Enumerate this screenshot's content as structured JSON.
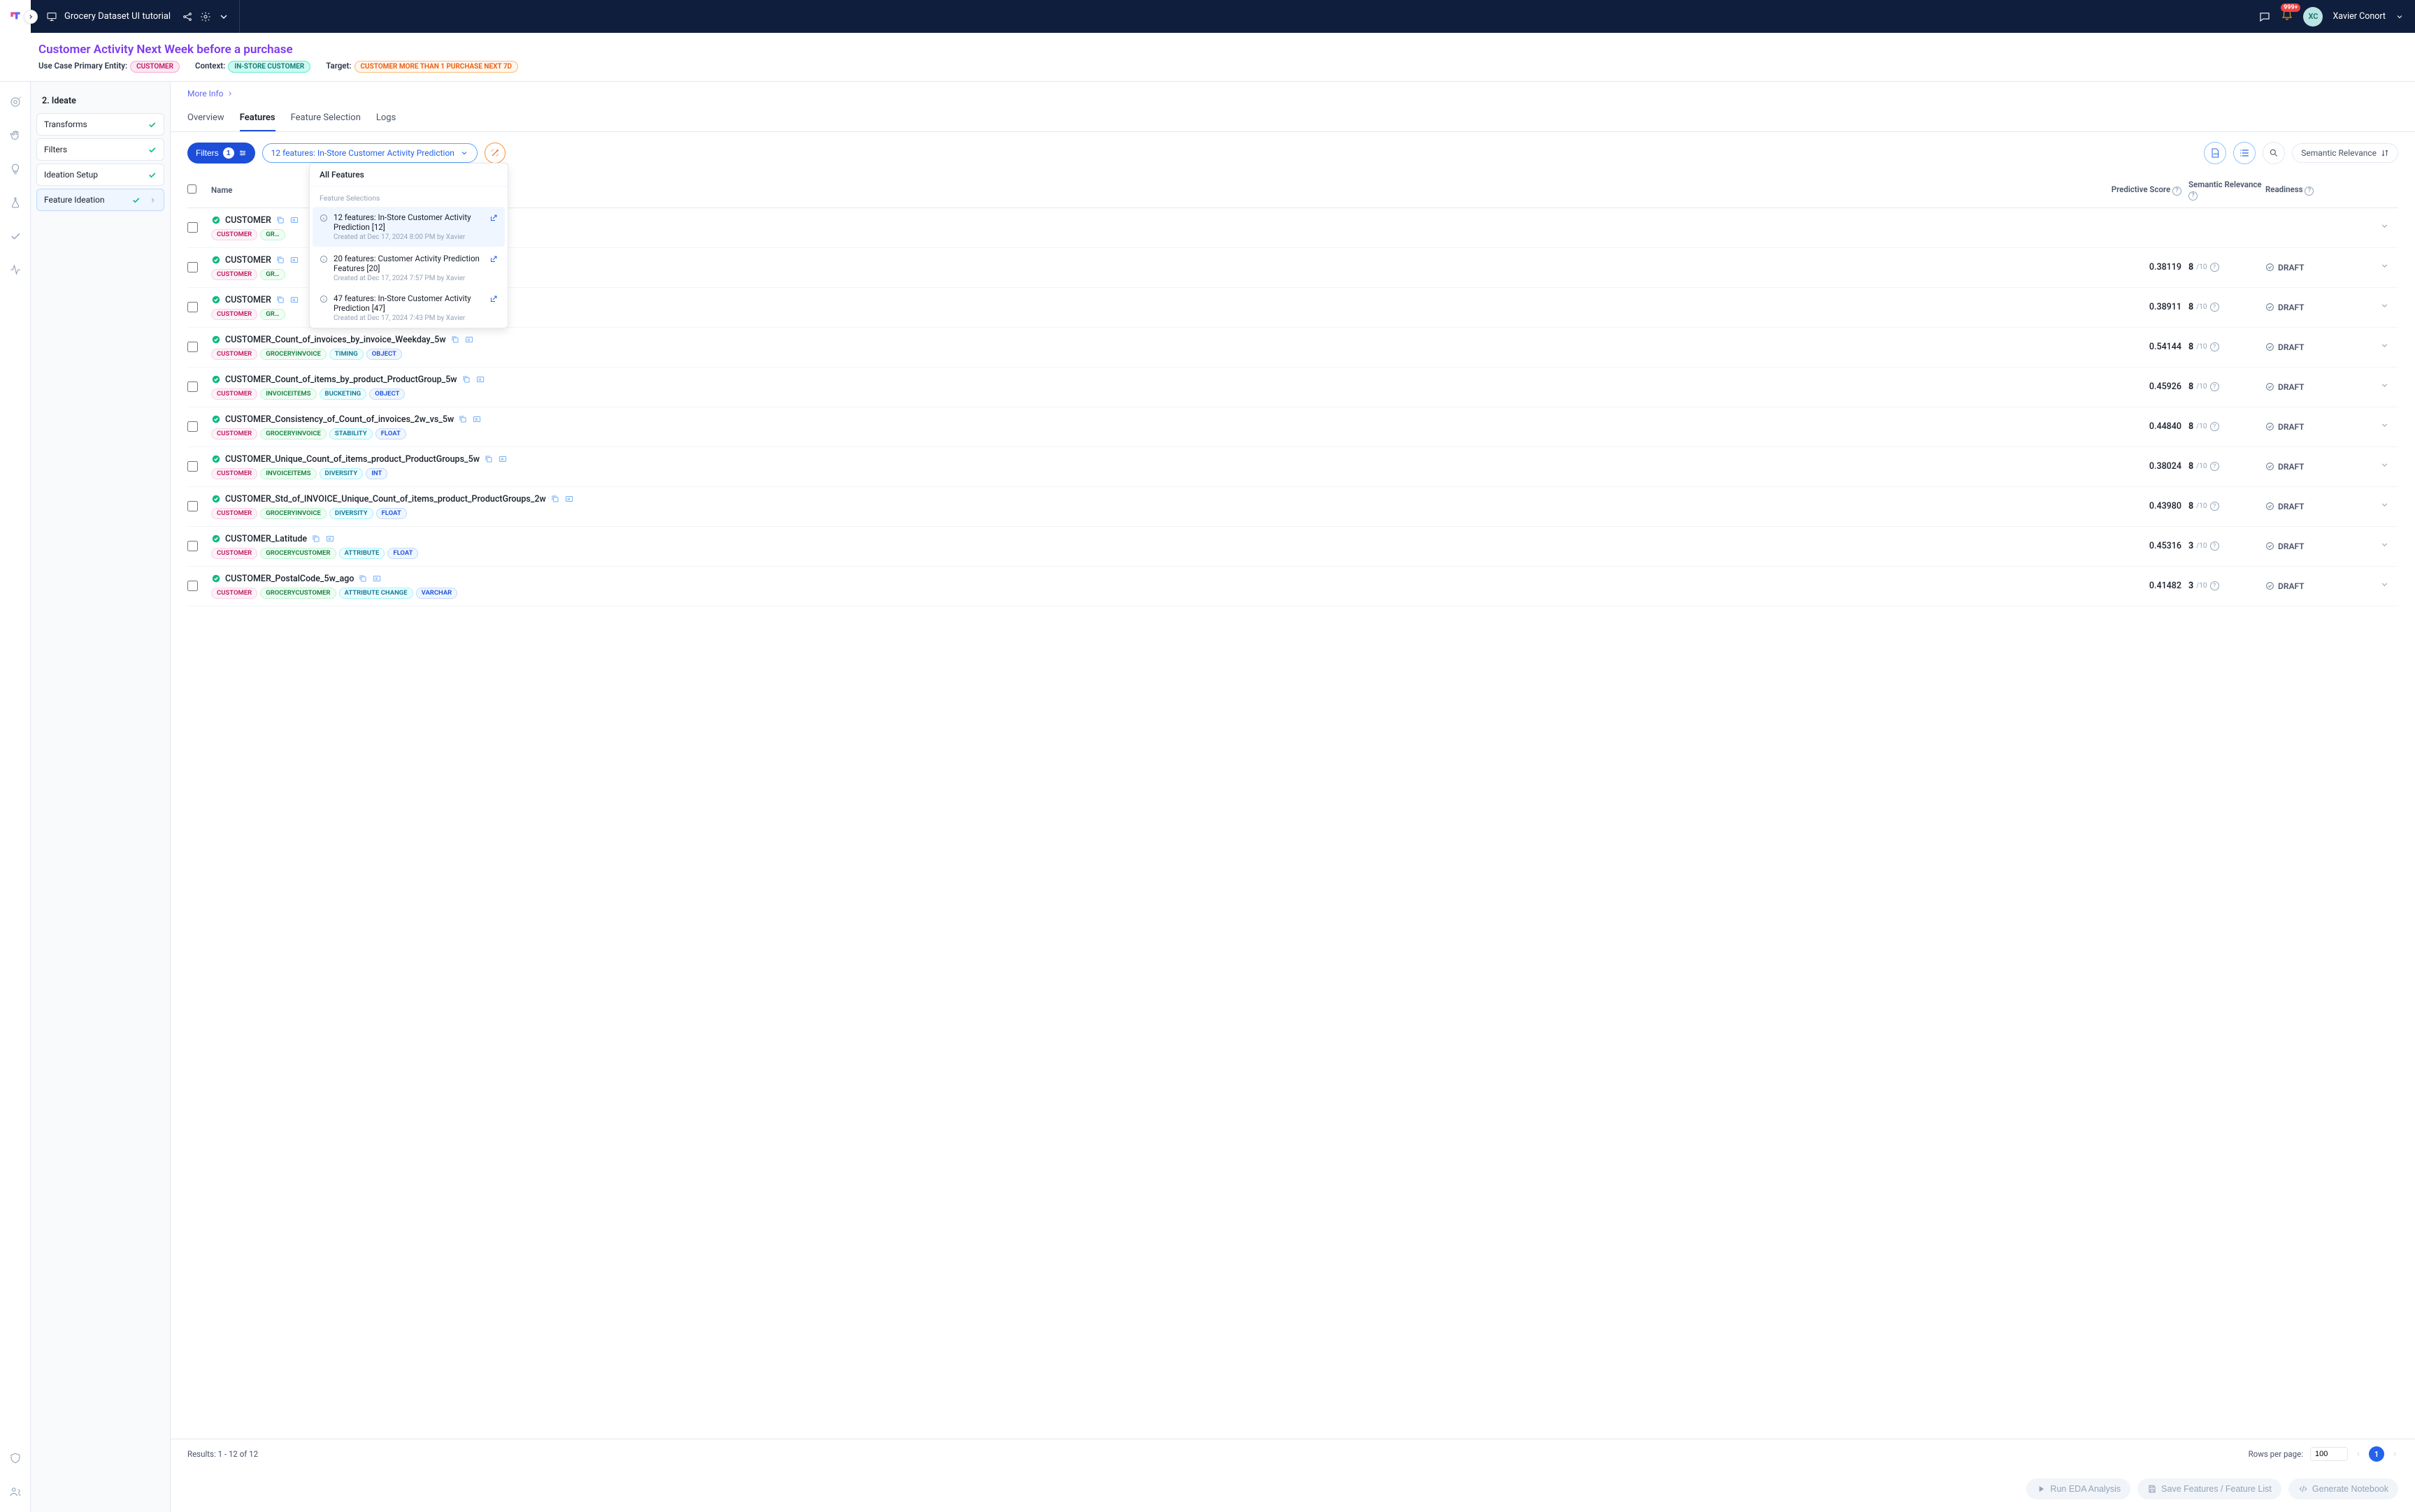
{
  "topbar": {
    "project": "Grocery Dataset UI tutorial",
    "user_name": "Xavier Conort",
    "user_initials": "XC",
    "notif_badge": "999+"
  },
  "header": {
    "title": "Customer Activity Next Week before a purchase",
    "entity_label": "Use Case Primary Entity:",
    "entity_chip": "CUSTOMER",
    "context_label": "Context:",
    "context_chip": "IN-STORE CUSTOMER",
    "target_label": "Target:",
    "target_chip": "CUSTOMER MORE THAN 1 PURCHASE NEXT 7D"
  },
  "more_info": "More Info",
  "nav": {
    "section": "2. Ideate",
    "items": [
      {
        "label": "Transforms"
      },
      {
        "label": "Filters"
      },
      {
        "label": "Ideation Setup"
      },
      {
        "label": "Feature Ideation",
        "active": true,
        "chevron": true
      }
    ]
  },
  "tabs": [
    "Overview",
    "Features",
    "Feature Selection",
    "Logs"
  ],
  "active_tab": "Features",
  "filters": {
    "label": "Filters",
    "count": "1"
  },
  "selection_dd": "12 features: In-Store Customer Activity Prediction",
  "popover": {
    "all": "All Features",
    "section": "Feature Selections",
    "items": [
      {
        "name": "12 features: In-Store Customer Activity Prediction [12]",
        "meta": "Created at Dec 17, 2024 8:00 PM by Xavier",
        "active": true
      },
      {
        "name": "20 features: Customer Activity Prediction Features [20]",
        "meta": "Created at Dec 17, 2024 7:57 PM by Xavier"
      },
      {
        "name": "47 features: In-Store Customer Activity Prediction [47]",
        "meta": "Created at Dec 17, 2024 7:43 PM by Xavier"
      }
    ]
  },
  "sort_label": "Semantic Relevance",
  "columns": {
    "name": "Name",
    "score": "Predictive Score",
    "sem": "Semantic Relevance",
    "ready": "Readiness"
  },
  "rows": [
    {
      "name": "CUSTOMER",
      "truncated": true,
      "score": "",
      "sem": "",
      "ready": "",
      "tags": [
        [
          "CUSTOMER",
          "pink"
        ],
        [
          "GR…",
          "green"
        ]
      ]
    },
    {
      "name": "CUSTOMER",
      "truncated": true,
      "score": "0.38119",
      "sem": "8",
      "ready": "DRAFT",
      "tags": [
        [
          "CUSTOMER",
          "pink"
        ],
        [
          "GR…",
          "green"
        ]
      ]
    },
    {
      "name": "CUSTOMER",
      "truncated": true,
      "score": "0.38911",
      "sem": "8",
      "ready": "DRAFT",
      "tags": [
        [
          "CUSTOMER",
          "pink"
        ],
        [
          "GR…",
          "green"
        ]
      ]
    },
    {
      "name": "CUSTOMER_Count_of_invoices_by_invoice_Weekday_5w",
      "score": "0.54144",
      "sem": "8",
      "ready": "DRAFT",
      "tags": [
        [
          "CUSTOMER",
          "pink"
        ],
        [
          "GROCERYINVOICE",
          "green"
        ],
        [
          "TIMING",
          "cyan"
        ],
        [
          "OBJECT",
          "blue"
        ]
      ]
    },
    {
      "name": "CUSTOMER_Count_of_items_by_product_ProductGroup_5w",
      "score": "0.45926",
      "sem": "8",
      "ready": "DRAFT",
      "tags": [
        [
          "CUSTOMER",
          "pink"
        ],
        [
          "INVOICEITEMS",
          "green"
        ],
        [
          "BUCKETING",
          "cyan"
        ],
        [
          "OBJECT",
          "blue"
        ]
      ]
    },
    {
      "name": "CUSTOMER_Consistency_of_Count_of_invoices_2w_vs_5w",
      "score": "0.44840",
      "sem": "8",
      "ready": "DRAFT",
      "tags": [
        [
          "CUSTOMER",
          "pink"
        ],
        [
          "GROCERYINVOICE",
          "green"
        ],
        [
          "STABILITY",
          "cyan"
        ],
        [
          "FLOAT",
          "blue"
        ]
      ]
    },
    {
      "name": "CUSTOMER_Unique_Count_of_items_product_ProductGroups_5w",
      "score": "0.38024",
      "sem": "8",
      "ready": "DRAFT",
      "tags": [
        [
          "CUSTOMER",
          "pink"
        ],
        [
          "INVOICEITEMS",
          "green"
        ],
        [
          "DIVERSITY",
          "cyan"
        ],
        [
          "INT",
          "blue"
        ]
      ]
    },
    {
      "name": "CUSTOMER_Std_of_INVOICE_Unique_Count_of_items_product_ProductGroups_2w",
      "score": "0.43980",
      "sem": "8",
      "ready": "DRAFT",
      "tags": [
        [
          "CUSTOMER",
          "pink"
        ],
        [
          "GROCERYINVOICE",
          "green"
        ],
        [
          "DIVERSITY",
          "cyan"
        ],
        [
          "FLOAT",
          "blue"
        ]
      ]
    },
    {
      "name": "CUSTOMER_Latitude",
      "score": "0.45316",
      "sem": "3",
      "ready": "DRAFT",
      "tags": [
        [
          "CUSTOMER",
          "pink"
        ],
        [
          "GROCERYCUSTOMER",
          "green"
        ],
        [
          "ATTRIBUTE",
          "cyan"
        ],
        [
          "FLOAT",
          "blue"
        ]
      ]
    },
    {
      "name": "CUSTOMER_PostalCode_5w_ago",
      "score": "0.41482",
      "sem": "3",
      "ready": "DRAFT",
      "tags": [
        [
          "CUSTOMER",
          "pink"
        ],
        [
          "GROCERYCUSTOMER",
          "green"
        ],
        [
          "ATTRIBUTE CHANGE",
          "cyan"
        ],
        [
          "VARCHAR",
          "blue"
        ]
      ]
    }
  ],
  "sem_denom": "/10",
  "footer": {
    "results": "Results: 1 - 12 of 12",
    "rows_label": "Rows per page:",
    "rows_value": "100",
    "page": "1"
  },
  "actions": {
    "eda": "Run EDA Analysis",
    "save": "Save Features / Feature List",
    "notebook": "Generate Notebook"
  }
}
